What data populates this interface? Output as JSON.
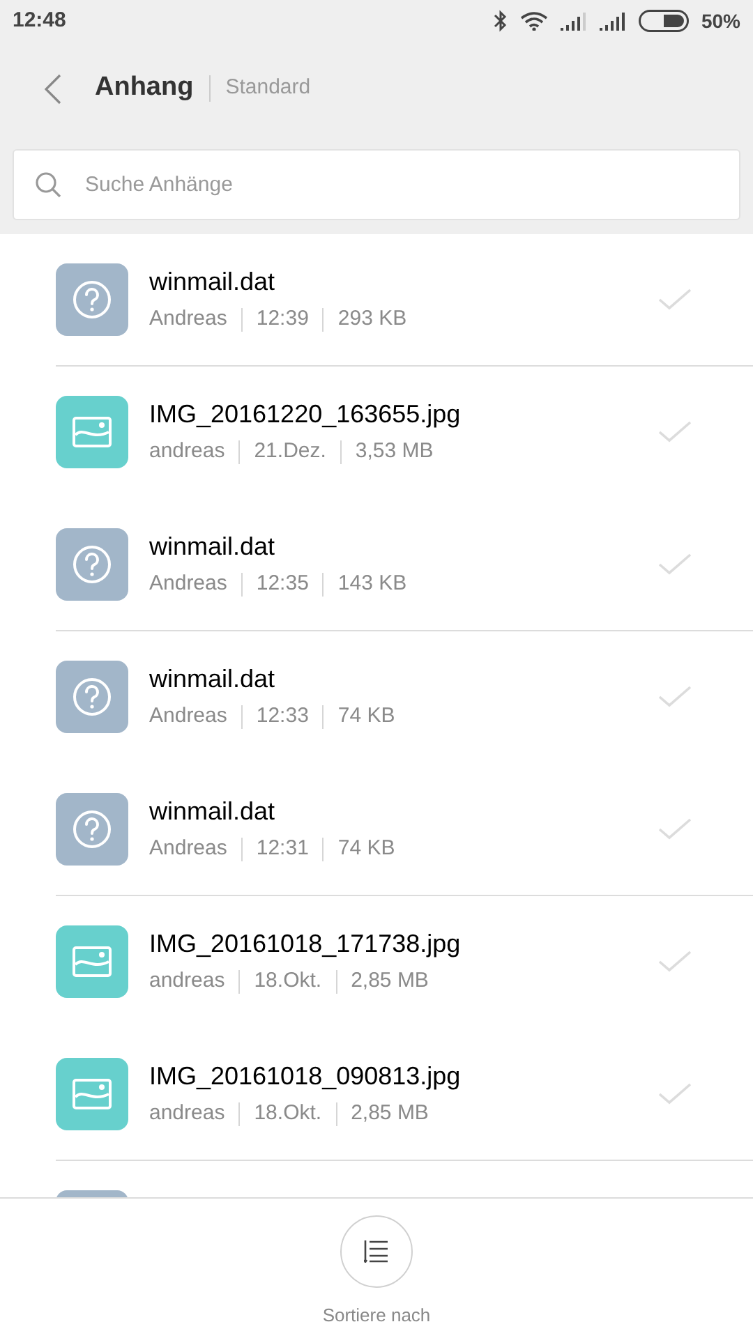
{
  "status_bar": {
    "time": "12:48",
    "battery": "50%"
  },
  "header": {
    "title": "Anhang",
    "subtitle": "Standard"
  },
  "search": {
    "placeholder": "Suche Anhänge"
  },
  "attachments": [
    {
      "kind": "unknown",
      "name": "winmail.dat",
      "sender": "Andreas",
      "date": "12:39",
      "size": "293 KB",
      "checked": false,
      "divider_after": true
    },
    {
      "kind": "image",
      "name": "IMG_20161220_163655.jpg",
      "sender": "andreas",
      "date": "21.Dez.",
      "size": "3,53 MB",
      "checked": false,
      "divider_after": false
    },
    {
      "kind": "unknown",
      "name": "winmail.dat",
      "sender": "Andreas",
      "date": "12:35",
      "size": "143 KB",
      "checked": false,
      "divider_after": true
    },
    {
      "kind": "unknown",
      "name": "winmail.dat",
      "sender": "Andreas",
      "date": "12:33",
      "size": "74 KB",
      "checked": false,
      "divider_after": false
    },
    {
      "kind": "unknown",
      "name": "winmail.dat",
      "sender": "Andreas",
      "date": "12:31",
      "size": "74 KB",
      "checked": false,
      "divider_after": true
    },
    {
      "kind": "image",
      "name": "IMG_20161018_171738.jpg",
      "sender": "andreas",
      "date": "18.Okt.",
      "size": "2,85 MB",
      "checked": false,
      "divider_after": false
    },
    {
      "kind": "image",
      "name": "IMG_20161018_090813.jpg",
      "sender": "andreas",
      "date": "18.Okt.",
      "size": "2,85 MB",
      "checked": false,
      "divider_after": true
    }
  ],
  "partial_item": {
    "kind": "unknown"
  },
  "sort_button": {
    "label": "Sortiere nach"
  }
}
